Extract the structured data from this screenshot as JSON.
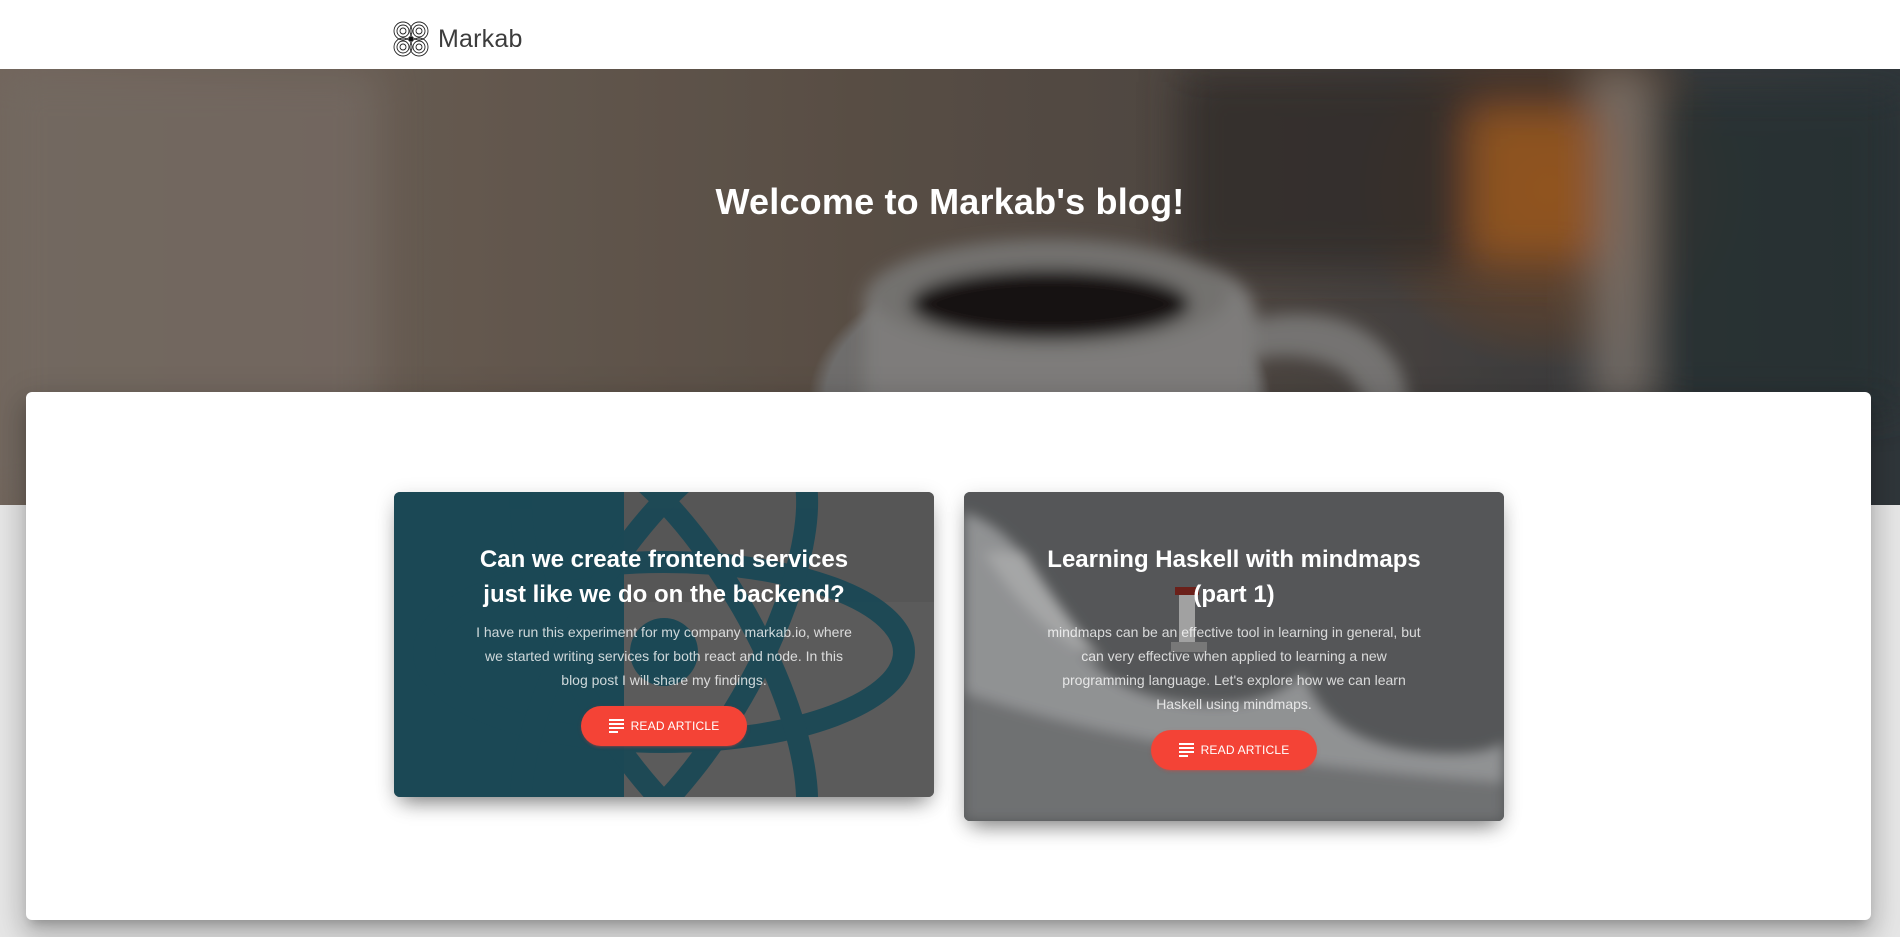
{
  "navbar": {
    "brand_name": "Markab",
    "logo_icon": "four-petal-logo-icon"
  },
  "hero": {
    "title": "Welcome to Markab's blog!"
  },
  "articles": [
    {
      "title": "Can we create frontend services just like we do on the backend?",
      "description": "I have run this experiment for my company markab.io, where we started writing services for both react and node. In this blog post I will share my findings.",
      "button_label": "READ ARTICLE",
      "button_icon": "notes-icon",
      "background_icon": "react-atom-icon"
    },
    {
      "title": "Learning Haskell with mindmaps (part 1)",
      "description": "mindmaps can be an effective tool in learning in general, but can very effective when applied to learning a new programming language. Let's explore how we can learn Haskell using mindmaps.",
      "button_label": "READ ARTICLE",
      "button_icon": "notes-icon",
      "background_icon": "lighthouse-waves-image"
    }
  ],
  "colors": {
    "accent": "#f44336",
    "card1_tint": "#235d6e",
    "panel": "#ffffff"
  }
}
